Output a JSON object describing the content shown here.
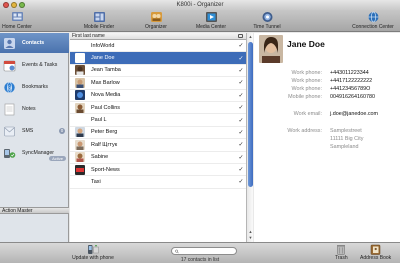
{
  "window": {
    "title": "K800i - Organizer"
  },
  "toolbar": {
    "items": [
      {
        "label": "Home Center",
        "icon": "home-center-icon"
      },
      {
        "label": "Mobile Finder",
        "icon": "mobile-finder-icon"
      },
      {
        "label": "Organizer",
        "icon": "organizer-icon"
      },
      {
        "label": "Media Center",
        "icon": "media-center-icon"
      },
      {
        "label": "Time Tunnel",
        "icon": "time-tunnel-icon"
      },
      {
        "label": "Connection Center",
        "icon": "connection-center-icon"
      }
    ]
  },
  "sidebar": {
    "items": [
      {
        "label": "Contacts",
        "icon": "contacts-icon",
        "active": true
      },
      {
        "label": "Events & Tasks",
        "icon": "calendar-icon"
      },
      {
        "label": "Bookmarks",
        "icon": "bookmarks-icon"
      },
      {
        "label": "Notes",
        "icon": "notes-icon"
      },
      {
        "label": "SMS",
        "icon": "sms-icon",
        "badge": "0"
      },
      {
        "label": "SyncManager",
        "icon": "sync-icon",
        "pill": "Active"
      }
    ],
    "action_master": "Action Master"
  },
  "list": {
    "header": "First last name",
    "contacts": [
      {
        "name": "InfoWorld",
        "checked": "✓"
      },
      {
        "name": "Jane Doe",
        "checked": "✓",
        "selected": true
      },
      {
        "name": "Jean Tamba",
        "checked": "✓"
      },
      {
        "name": "Max Barlow",
        "checked": "✓"
      },
      {
        "name": "Nova Media",
        "checked": "✓"
      },
      {
        "name": "Paul Collins",
        "checked": "✓"
      },
      {
        "name": "Paul L",
        "checked": "✓"
      },
      {
        "name": "Peter Berg",
        "checked": "✓"
      },
      {
        "name": "Ralf Щгтук",
        "checked": "✓"
      },
      {
        "name": "Sabine",
        "checked": "✓"
      },
      {
        "name": "Sport-News",
        "checked": "✓"
      },
      {
        "name": "Taxi",
        "checked": "✓"
      }
    ]
  },
  "detail": {
    "name": "Jane Doe",
    "work_phone_label": "Work phone:",
    "work_phone_1": "+443011223344",
    "work_phone_2": "+4417122222222",
    "work_phone_3": "+44123456789O",
    "mobile_label": "Mobile phone:",
    "mobile_phone": "004916264160780",
    "email_label": "Work email:",
    "email": "j.doe@janedoe.com",
    "address_label": "Work address:",
    "address_street": "Samplestreet",
    "address_city": "11111 Big City",
    "address_region": "Sampleland"
  },
  "bottom": {
    "update_label": "Update with phone",
    "search_placeholder": "",
    "trash_label": "Trash",
    "address_book_label": "Address Book",
    "status": "17 contacts in list"
  },
  "colors": {
    "selection": "#3d6cb8",
    "sidebar_active": "#4a72ad",
    "scroll_thumb": "#3d6cc0"
  }
}
